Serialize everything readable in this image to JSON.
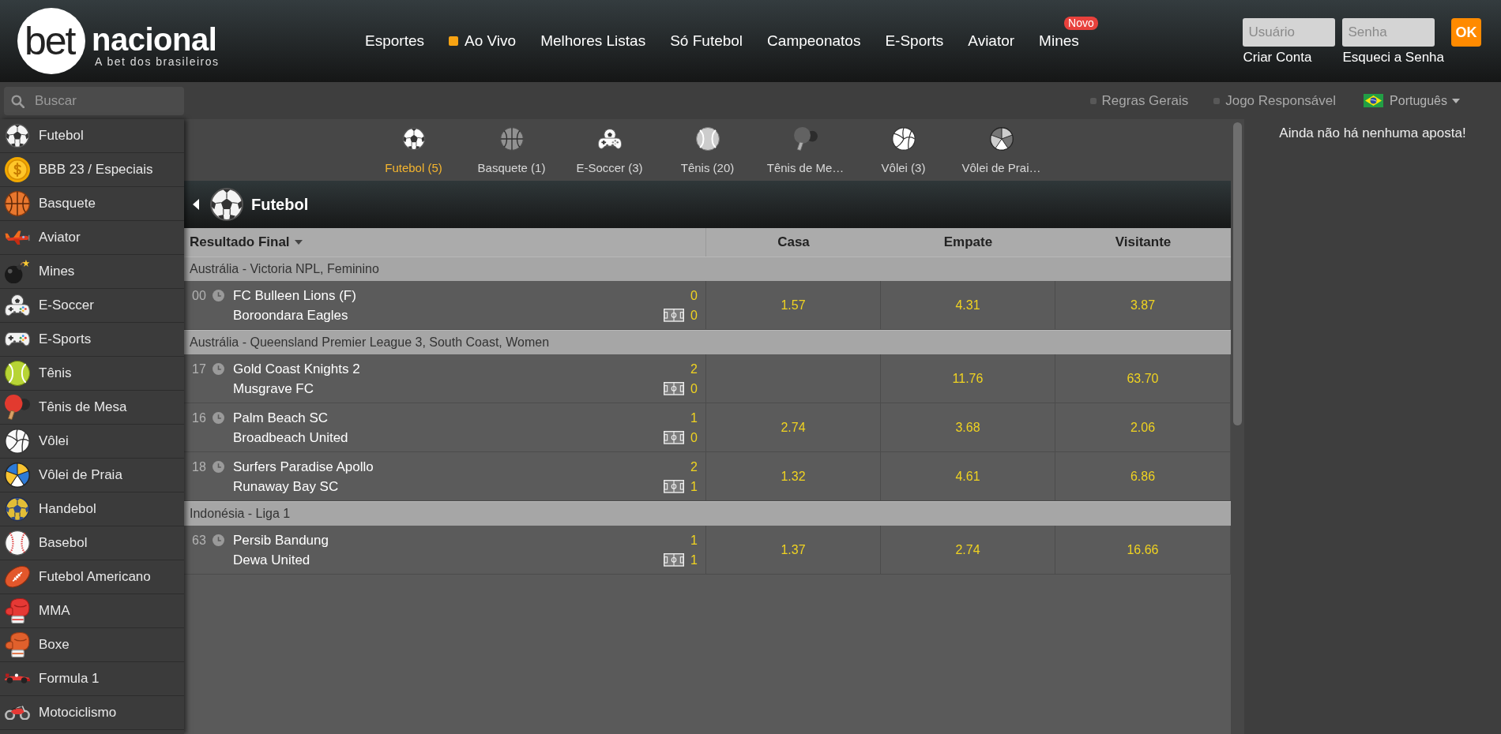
{
  "header": {
    "logo": {
      "mark": "bet",
      "wordmark": "nacional",
      "tagline": "A bet dos brasileiros"
    },
    "nav": [
      {
        "label": "Esportes",
        "live": false
      },
      {
        "label": "Ao Vivo",
        "live": true
      },
      {
        "label": "Melhores Listas",
        "live": false
      },
      {
        "label": "Só Futebol",
        "live": false
      },
      {
        "label": "Campeonatos",
        "live": false
      },
      {
        "label": "E-Sports",
        "live": false
      },
      {
        "label": "Aviator",
        "live": false
      },
      {
        "label": "Mines",
        "live": false,
        "badge": "Novo"
      }
    ],
    "login": {
      "username": {
        "placeholder": "Usuário"
      },
      "password": {
        "placeholder": "Senha"
      },
      "submit": "OK",
      "links": [
        "Criar Conta",
        "Esqueci a Senha"
      ]
    }
  },
  "search": {
    "placeholder": "Buscar"
  },
  "info_links": [
    {
      "label": "Regras Gerais"
    },
    {
      "label": "Jogo Responsável"
    }
  ],
  "language": {
    "label": "Português"
  },
  "sidebar": {
    "items": [
      {
        "label": "Futebol",
        "kind": "soccer"
      },
      {
        "label": "BBB 23 / Especiais",
        "kind": "coin"
      },
      {
        "label": "Basquete",
        "kind": "basketball"
      },
      {
        "label": "Aviator",
        "kind": "plane"
      },
      {
        "label": "Mines",
        "kind": "bomb"
      },
      {
        "label": "E-Soccer",
        "kind": "esoccer"
      },
      {
        "label": "E-Sports",
        "kind": "gamepad"
      },
      {
        "label": "Tênis",
        "kind": "tennis"
      },
      {
        "label": "Tênis de Mesa",
        "kind": "pingpong"
      },
      {
        "label": "Vôlei",
        "kind": "volleyball"
      },
      {
        "label": "Vôlei de Praia",
        "kind": "beachvolley"
      },
      {
        "label": "Handebol",
        "kind": "handball"
      },
      {
        "label": "Basebol",
        "kind": "baseball"
      },
      {
        "label": "Futebol Americano",
        "kind": "football"
      },
      {
        "label": "MMA",
        "kind": "mma"
      },
      {
        "label": "Boxe",
        "kind": "boxing"
      },
      {
        "label": "Formula 1",
        "kind": "racing"
      },
      {
        "label": "Motociclismo",
        "kind": "motorcycle"
      }
    ]
  },
  "sport_tabs": [
    {
      "label": "Futebol (5)",
      "kind": "soccer",
      "selected": true
    },
    {
      "label": "Basquete (1)",
      "kind": "basketball",
      "selected": false
    },
    {
      "label": "E-Soccer (3)",
      "kind": "esoccer",
      "selected": false
    },
    {
      "label": "Tênis (20)",
      "kind": "tennis",
      "selected": false
    },
    {
      "label": "Tênis de Me…",
      "kind": "pingpong",
      "selected": false
    },
    {
      "label": "Vôlei (3)",
      "kind": "volleyball",
      "selected": false
    },
    {
      "label": "Vôlei de Prai…",
      "kind": "beachvolley",
      "selected": false
    }
  ],
  "section": {
    "title": "Futebol",
    "kind": "soccer"
  },
  "table": {
    "columns": [
      "Resultado Final",
      "Casa",
      "Empate",
      "Visitante"
    ],
    "groups": [
      {
        "league": "Austrália - Victoria NPL, Feminino",
        "matches": [
          {
            "minute": "00",
            "teams": [
              {
                "name": "FC Bulleen Lions (F)",
                "score": "0"
              },
              {
                "name": "Boroondara Eagles",
                "score": "0"
              }
            ],
            "odds": {
              "home": "1.57",
              "draw": "4.31",
              "away": "3.87"
            }
          }
        ]
      },
      {
        "league": "Austrália - Queensland Premier League 3, South Coast, Women",
        "matches": [
          {
            "minute": "17",
            "teams": [
              {
                "name": "Gold Coast Knights 2",
                "score": "2"
              },
              {
                "name": "Musgrave FC",
                "score": "0"
              }
            ],
            "odds": {
              "draw": "11.76",
              "away": "63.70"
            }
          },
          {
            "minute": "16",
            "teams": [
              {
                "name": "Palm Beach SC",
                "score": "1"
              },
              {
                "name": "Broadbeach United",
                "score": "0"
              }
            ],
            "odds": {
              "home": "2.74",
              "draw": "3.68",
              "away": "2.06"
            }
          },
          {
            "minute": "18",
            "teams": [
              {
                "name": "Surfers Paradise Apollo",
                "score": "2"
              },
              {
                "name": "Runaway Bay SC",
                "score": "1"
              }
            ],
            "odds": {
              "home": "1.32",
              "draw": "4.61",
              "away": "6.86"
            }
          }
        ]
      },
      {
        "league": "Indonésia - Liga 1",
        "matches": [
          {
            "minute": "63",
            "teams": [
              {
                "name": "Persib Bandung",
                "score": "1"
              },
              {
                "name": "Dewa United",
                "score": "1"
              }
            ],
            "odds": {
              "home": "1.37",
              "draw": "2.74",
              "away": "16.66"
            }
          }
        ]
      }
    ]
  },
  "betslip": {
    "message": "Ainda não há nenhuma aposta!"
  }
}
